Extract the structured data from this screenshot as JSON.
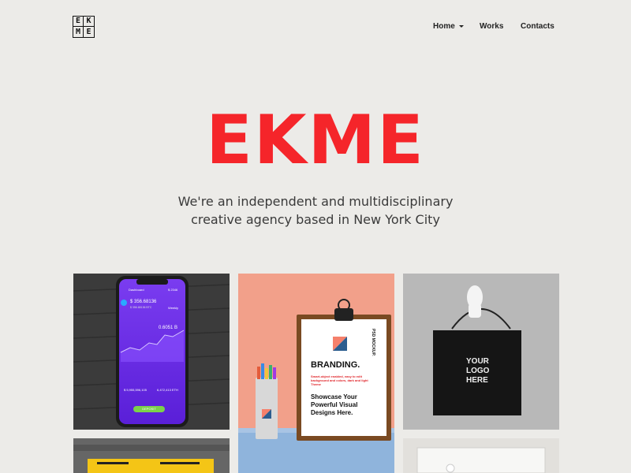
{
  "logo": {
    "letters": [
      "E",
      "K",
      "M",
      "E"
    ]
  },
  "nav": {
    "home": "Home",
    "works": "Works",
    "contacts": "Contacts"
  },
  "hero": {
    "title": "EKME",
    "subtitle_line1": "We're an independent and multidisciplinary",
    "subtitle_line2": "creative agency based in New York City"
  },
  "gallery": {
    "phone": {
      "app_title": "Dashboard",
      "balance": "$ 356.68136",
      "balance_sub": "$ 356.68136 BTC",
      "period": "Weekly",
      "value_main": "0.6051 B",
      "top_right": "$ 2346",
      "bottom_left": "$ 5,955,596,105",
      "bottom_right": "6,472,413 ETH",
      "button": "DEPOSIT"
    },
    "branding": {
      "side_text": "PSD MOCKUP.",
      "heading": "BRANDING.",
      "red_text": "Smart-object enabled, easy to edit background and colors, dark and light Theme",
      "showcase": "Showcase Your Powerful Visual Designs Here."
    },
    "bag": {
      "text": "YOUR LOGO HERE"
    }
  },
  "colors": {
    "accent": "#f5252a",
    "background": "#ecebe8"
  }
}
